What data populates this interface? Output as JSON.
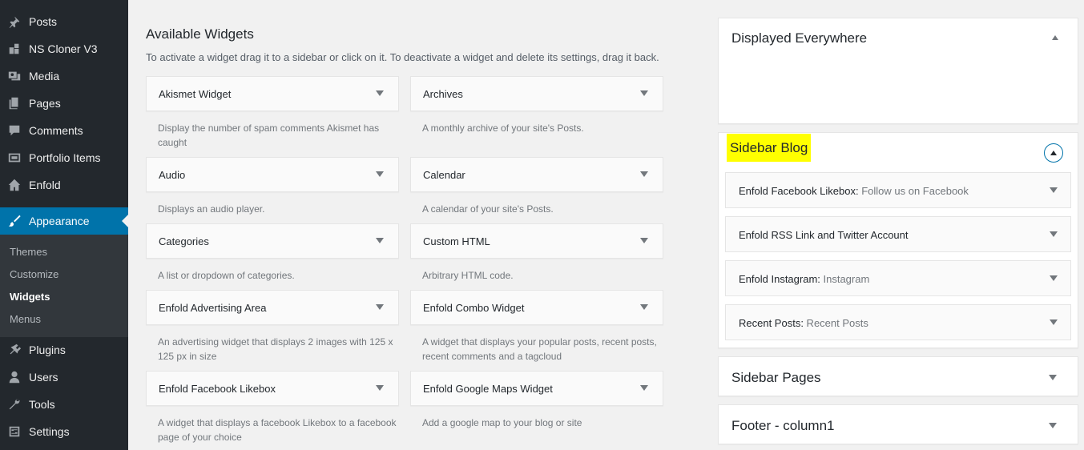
{
  "sidebar": {
    "items": [
      {
        "label": "Posts",
        "icon": "pin-icon"
      },
      {
        "label": "NS Cloner V3",
        "icon": "cloner-icon"
      },
      {
        "label": "Media",
        "icon": "media-icon"
      },
      {
        "label": "Pages",
        "icon": "pages-icon"
      },
      {
        "label": "Comments",
        "icon": "comments-icon"
      },
      {
        "label": "Portfolio Items",
        "icon": "portfolio-icon"
      },
      {
        "label": "Enfold",
        "icon": "home-icon"
      },
      {
        "label": "Appearance",
        "icon": "brush-icon"
      },
      {
        "label": "Plugins",
        "icon": "plugin-icon"
      },
      {
        "label": "Users",
        "icon": "users-icon"
      },
      {
        "label": "Tools",
        "icon": "wrench-icon"
      },
      {
        "label": "Settings",
        "icon": "settings-icon"
      }
    ],
    "submenu": [
      "Themes",
      "Customize",
      "Widgets",
      "Menus"
    ],
    "colors": {
      "bg": "#23282d",
      "current": "#0073aa",
      "submenu_bg": "#32373c"
    }
  },
  "available": {
    "title": "Available Widgets",
    "description": "To activate a widget drag it to a sidebar or click on it. To deactivate a widget and delete its settings, drag it back.",
    "widgets": [
      {
        "name": "Akismet Widget",
        "desc": "Display the number of spam comments Akismet has caught"
      },
      {
        "name": "Archives",
        "desc": "A monthly archive of your site's Posts."
      },
      {
        "name": "Audio",
        "desc": "Displays an audio player."
      },
      {
        "name": "Calendar",
        "desc": "A calendar of your site's Posts."
      },
      {
        "name": "Categories",
        "desc": "A list or dropdown of categories."
      },
      {
        "name": "Custom HTML",
        "desc": "Arbitrary HTML code."
      },
      {
        "name": "Enfold Advertising Area",
        "desc": "An advertising widget that displays 2 images with 125 x 125 px in size"
      },
      {
        "name": "Enfold Combo Widget",
        "desc": "A widget that displays your popular posts, recent posts, recent comments and a tagcloud"
      },
      {
        "name": "Enfold Facebook Likebox",
        "desc": "A widget that displays a facebook Likebox to a facebook page of your choice"
      },
      {
        "name": "Enfold Google Maps Widget",
        "desc": "Add a google map to your blog or site"
      }
    ]
  },
  "sidebars": {
    "displayed_everywhere": "Displayed Everywhere",
    "sidebar_blog": "Sidebar Blog",
    "sidebar_blog_widgets": [
      {
        "name": "Enfold Facebook Likebox:",
        "sub": " Follow us on Facebook"
      },
      {
        "name": "Enfold RSS Link and Twitter Account",
        "sub": ""
      },
      {
        "name": "Enfold Instagram:",
        "sub": " Instagram"
      },
      {
        "name": "Recent Posts:",
        "sub": " Recent Posts"
      }
    ],
    "sidebar_pages": "Sidebar Pages",
    "footer_column1": "Footer - column1",
    "highlight_color": "#ffff00"
  }
}
